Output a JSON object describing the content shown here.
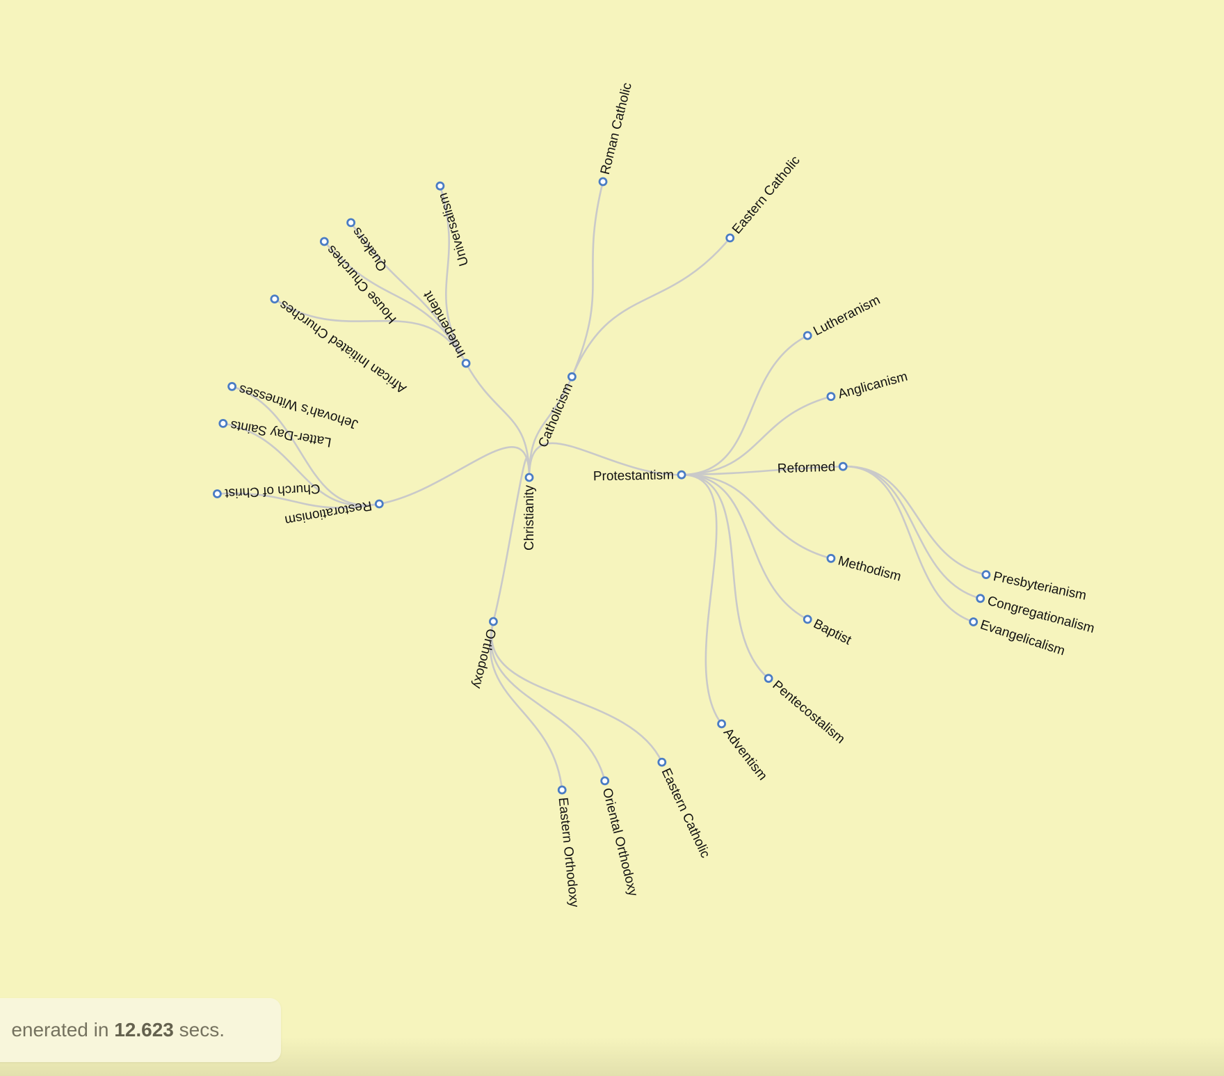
{
  "diagram": {
    "type": "radial-tree",
    "colors": {
      "background": "#f6f4bd",
      "link": "#c9c9c9",
      "node_stroke": "#4a7cc4",
      "node_fill": "#ffffff",
      "label": "#111111"
    },
    "root": {
      "name": "Christianity",
      "children": [
        {
          "name": "Catholicism",
          "children": [
            {
              "name": "Roman Catholic"
            },
            {
              "name": "Eastern Catholic"
            }
          ]
        },
        {
          "name": "Protestantism",
          "children": [
            {
              "name": "Lutheranism"
            },
            {
              "name": "Anglicanism"
            },
            {
              "name": "Reformed",
              "children": [
                {
                  "name": "Presbyterianism"
                },
                {
                  "name": "Congregationalism"
                },
                {
                  "name": "Evangelicalism"
                }
              ]
            },
            {
              "name": "Methodism"
            },
            {
              "name": "Baptist"
            },
            {
              "name": "Pentecostalism"
            },
            {
              "name": "Adventism"
            }
          ]
        },
        {
          "name": "Orthodoxy",
          "children": [
            {
              "name": "Eastern Orthodoxy"
            },
            {
              "name": "Oriental Orthodoxy"
            },
            {
              "name": "Eastern Catholic"
            }
          ]
        },
        {
          "name": "Restorationism",
          "children": [
            {
              "name": "Jehovah's Witnesses"
            },
            {
              "name": "Latter-Day Saints"
            },
            {
              "name": "Church of Christ"
            }
          ]
        },
        {
          "name": "Independent",
          "children": [
            {
              "name": "African Initiated Churches"
            },
            {
              "name": "House Churches"
            },
            {
              "name": "Quakers"
            },
            {
              "name": "Universalism"
            }
          ]
        }
      ]
    }
  },
  "status": {
    "prefix": "enerated in",
    "time": "12.623",
    "suffix": "secs."
  }
}
